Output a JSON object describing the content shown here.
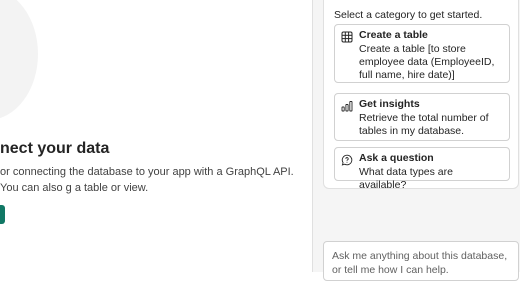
{
  "connect": {
    "title": "nect your data",
    "description": "or connecting the database to your app with a GraphQL API. You can also g a table or view."
  },
  "copilot": {
    "instruction": "Select a category to get started.",
    "suggestions": [
      {
        "icon": "table-icon",
        "title": "Create a table",
        "description": "Create a table [to store employee data (EmployeeID, full name, hire date)]"
      },
      {
        "icon": "chart-icon",
        "title": "Get insights",
        "description": "Retrieve the total number of tables in my database."
      },
      {
        "icon": "chat-question-icon",
        "title": "Ask a question",
        "description": "What data types are available?"
      }
    ],
    "input_placeholder": "Ask me anything about this database, or tell me how I can help."
  },
  "colors": {
    "accent": "#117865",
    "pane_background": "#f5f5f5",
    "border": "#d1d1d1"
  }
}
